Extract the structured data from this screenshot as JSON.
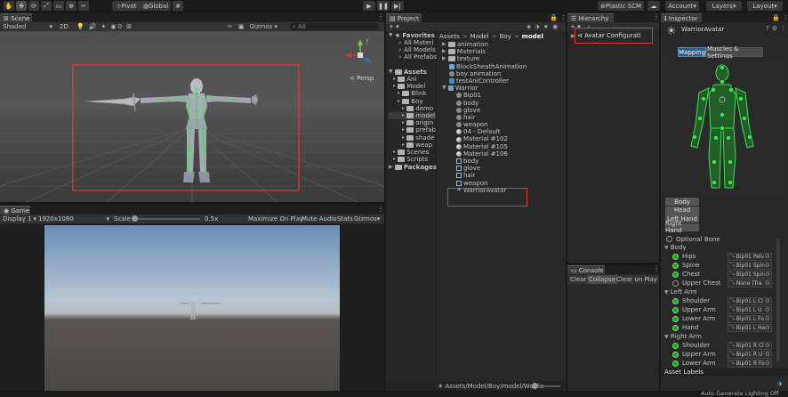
{
  "toolbar": {
    "pivot": "Pivot",
    "global": "Global",
    "plastic": "Plastic SCM",
    "account": "Account",
    "layers": "Layers",
    "layout": "Layout"
  },
  "scene": {
    "tab": "Scene",
    "shading": "Shaded",
    "mode2d": "2D",
    "gizmos": "Gizmos",
    "search": "All",
    "persp": "< Persp"
  },
  "game": {
    "tab": "Game",
    "display": "Display 1",
    "resolution": "1920x1080",
    "scale_label": "Scale",
    "scale_value": "0.5x",
    "maximize": "Maximize On Play",
    "mute": "Mute Audio",
    "stats": "Stats",
    "gizmos": "Gizmos"
  },
  "project": {
    "tab": "Project",
    "favorites": "Favorites",
    "fav_items": [
      "All Materi",
      "All Models",
      "All Prefabs"
    ],
    "assets": "Assets",
    "tree": [
      {
        "label": "Ani",
        "indent": 1
      },
      {
        "label": "Model",
        "indent": 1
      },
      {
        "label": "Blink",
        "indent": 2
      },
      {
        "label": "Boy",
        "indent": 2
      },
      {
        "label": "demo",
        "indent": 3
      },
      {
        "label": "model",
        "indent": 3
      },
      {
        "label": "origin",
        "indent": 3
      },
      {
        "label": "prefab",
        "indent": 3
      },
      {
        "label": "shade",
        "indent": 3
      },
      {
        "label": "weap",
        "indent": 3
      },
      {
        "label": "Scenes",
        "indent": 1
      },
      {
        "label": "Scripts",
        "indent": 1
      }
    ],
    "packages": "Packages",
    "breadcrumb": [
      "Assets",
      "Model",
      "Boy",
      "model"
    ],
    "files": [
      {
        "label": "animation",
        "icon": "folder-icon",
        "indent": 0
      },
      {
        "label": "Materials",
        "icon": "folder-icon",
        "indent": 0
      },
      {
        "label": "texture",
        "icon": "folder-icon",
        "indent": 0
      },
      {
        "label": "BlockSheathAnimation",
        "icon": "prefab-icon",
        "indent": 0
      },
      {
        "label": "boy animation",
        "icon": "animation-icon",
        "indent": 0
      },
      {
        "label": "testAniController",
        "icon": "controller-icon",
        "indent": 0
      },
      {
        "label": "Warrior",
        "icon": "prefab-icon",
        "indent": 0
      },
      {
        "label": "Bip01",
        "icon": "animation-icon",
        "indent": 1
      },
      {
        "label": "body",
        "icon": "animation-icon",
        "indent": 1
      },
      {
        "label": "glove",
        "icon": "animation-icon",
        "indent": 1
      },
      {
        "label": "hair",
        "icon": "animation-icon",
        "indent": 1
      },
      {
        "label": "weapon",
        "icon": "animation-icon",
        "indent": 1
      },
      {
        "label": "04 - Default",
        "icon": "material-icon",
        "indent": 1
      },
      {
        "label": "Material #102",
        "icon": "material-icon",
        "indent": 1
      },
      {
        "label": "Material #105",
        "icon": "material-icon",
        "indent": 1
      },
      {
        "label": "Material #106",
        "icon": "material-icon",
        "indent": 1
      },
      {
        "label": "body",
        "icon": "mesh-icon",
        "indent": 1
      },
      {
        "label": "glove",
        "icon": "mesh-icon",
        "indent": 1
      },
      {
        "label": "hair",
        "icon": "mesh-icon",
        "indent": 1
      },
      {
        "label": "weapon",
        "icon": "mesh-icon",
        "indent": 1
      },
      {
        "label": "WarriorAvatar",
        "icon": "avatar-icon",
        "indent": 1
      }
    ],
    "status_path": "Assets/Model/Boy/model/Warrio"
  },
  "hierarchy": {
    "tab": "Hierarchy",
    "item": "Avatar Configurati"
  },
  "console": {
    "tab": "Console",
    "clear": "Clear",
    "collapse": "Collapse",
    "clear_on_play": "Clear on Play"
  },
  "inspector": {
    "tab": "Inspector",
    "object": "WarriorAvatar",
    "tab_mapping": "Mapping",
    "tab_muscles": "Muscles & Settings",
    "body_buttons": [
      "Body",
      "Head",
      "Left Hand",
      "Right Hand"
    ],
    "optional_bone": "Optional Bone",
    "groups": [
      {
        "title": "Body",
        "bones": [
          {
            "name": "Hips",
            "value": "Bip01 Pelv",
            "assigned": true
          },
          {
            "name": "Spine",
            "value": "Bip01 Spin",
            "assigned": true
          },
          {
            "name": "Chest",
            "value": "Bip01 Spin",
            "assigned": true
          },
          {
            "name": "Upper Chest",
            "value": "None (Tra",
            "assigned": false
          }
        ]
      },
      {
        "title": "Left Arm",
        "bones": [
          {
            "name": "Shoulder",
            "value": "Bip01 L Cl",
            "assigned": true
          },
          {
            "name": "Upper Arm",
            "value": "Bip01 L U",
            "assigned": true
          },
          {
            "name": "Lower Arm",
            "value": "Bip01 L Fo",
            "assigned": true
          },
          {
            "name": "Hand",
            "value": "Bip01 L Ha",
            "assigned": true
          }
        ]
      },
      {
        "title": "Right Arm",
        "bones": [
          {
            "name": "Shoulder",
            "value": "Bip01 R Cl",
            "assigned": true
          },
          {
            "name": "Upper Arm",
            "value": "Bip01 R U",
            "assigned": true
          },
          {
            "name": "Lower Arm",
            "value": "Bip01 R Fo",
            "assigned": true
          }
        ]
      }
    ],
    "asset_labels": "Asset Labels"
  },
  "status": {
    "message": "Auto Generate Lighting Off"
  },
  "colors": {
    "accent": "#2c5d87",
    "highlight_box": "#e03a3a",
    "bone_green": "#23a31f"
  }
}
